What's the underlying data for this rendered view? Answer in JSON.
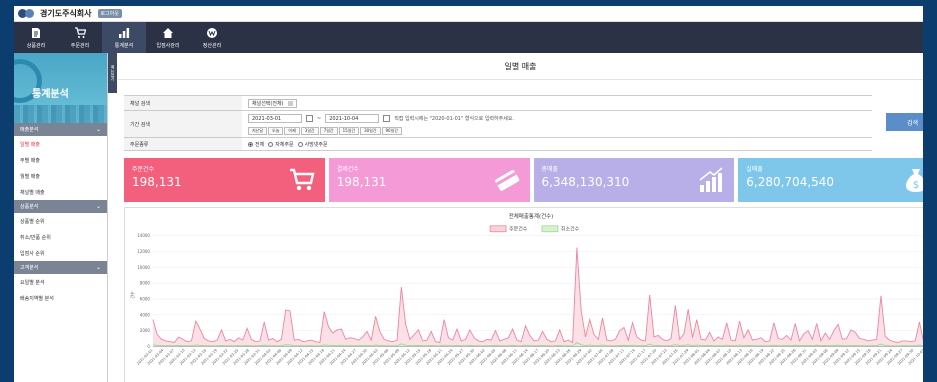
{
  "company": "경기도주식회사",
  "logout_label": "로그아웃",
  "nav": [
    {
      "label": "상품관리",
      "icon": "document-icon"
    },
    {
      "label": "주문관리",
      "icon": "cart-icon"
    },
    {
      "label": "통계분석",
      "icon": "bar-chart-icon",
      "active": true
    },
    {
      "label": "입점사관리",
      "icon": "home-icon"
    },
    {
      "label": "정산관리",
      "icon": "won-icon"
    }
  ],
  "sidebar": {
    "title": "통계분석",
    "toggle_label": "메뉴접기",
    "sections": [
      {
        "label": "매출분석",
        "items": [
          "일별 매출",
          "주별 매출",
          "월별 매출",
          "채널별 매출"
        ]
      },
      {
        "label": "상품분석",
        "items": [
          "상품별 순위",
          "취소/반품 순위",
          "입점사 순위"
        ]
      },
      {
        "label": "고객분석",
        "items": [
          "요일별 분석",
          "배송지역별 분석"
        ]
      }
    ],
    "active_item": "일별 매출"
  },
  "page_title": "일별 매출",
  "filter": {
    "channel_label": "채널 검색",
    "channel_value": "채널선택(전체)",
    "period_label": "기간 검색",
    "date_from": "2021-03-01",
    "date_sep": "~",
    "date_to": "2021-10-04",
    "hint": "직접 입력시에는 \"2020-01-01\" 형식으로 입력하주세요.",
    "quick": [
      "지난달",
      "오늘",
      "어제",
      "3일간",
      "7일간",
      "15일간",
      "30일간",
      "90일간"
    ],
    "order_type_label": "주문종류",
    "order_types": [
      "전체",
      "자체주문",
      "사방넷주문"
    ],
    "order_type_selected": "전체",
    "search_label": "검색"
  },
  "cards": [
    {
      "label": "주문건수",
      "value": "198,131",
      "color": "#f2607e",
      "icon": "cart-icon"
    },
    {
      "label": "결제건수",
      "value": "198,131",
      "color": "#f49ad6",
      "icon": "card-icon"
    },
    {
      "label": "총매출",
      "value": "6,348,130,310",
      "color": "#b8aee8",
      "icon": "growth-chart-icon"
    },
    {
      "label": "실매출",
      "value": "6,280,704,540",
      "color": "#7ec7ea",
      "icon": "money-bag-icon"
    }
  ],
  "chart_data": {
    "type": "line",
    "title": "전체매출통계(건수)",
    "ylabel": "건수",
    "ylim": [
      0,
      14000
    ],
    "yticks": [
      0,
      2000,
      4000,
      6000,
      8000,
      10000,
      12000,
      14000
    ],
    "legend_position": "top",
    "x_start": "2021-03-01",
    "x_end": "2021-10-04",
    "x_tick_labels": [
      "2021-03-01",
      "2021-03-04",
      "2021-03-07",
      "2021-03-10",
      "2021-03-13",
      "2021-03-16",
      "2021-03-19",
      "2021-03-22",
      "2021-03-25",
      "2021-03-28",
      "2021-03-31",
      "2021-04-03",
      "2021-04-06",
      "2021-04-09",
      "2021-04-12",
      "2021-04-15",
      "2021-04-18",
      "2021-04-21",
      "2021-04-24",
      "2021-04-27",
      "2021-04-30",
      "2021-05-03",
      "2021-05-06",
      "2021-05-09",
      "2021-05-12",
      "2021-05-15",
      "2021-05-18",
      "2021-05-21",
      "2021-05-24",
      "2021-05-27",
      "2021-05-30",
      "2021-06-02",
      "2021-06-05",
      "2021-06-08",
      "2021-06-11",
      "2021-06-14",
      "2021-06-17",
      "2021-06-20",
      "2021-06-23",
      "2021-06-26",
      "2021-06-29",
      "2021-07-02",
      "2021-07-05",
      "2021-07-08",
      "2021-07-11",
      "2021-07-14",
      "2021-07-17",
      "2021-07-20",
      "2021-07-23",
      "2021-07-26",
      "2021-07-29",
      "2021-08-01",
      "2021-08-04",
      "2021-08-07",
      "2021-08-10",
      "2021-08-13",
      "2021-08-16",
      "2021-08-19",
      "2021-08-22",
      "2021-08-25",
      "2021-08-28",
      "2021-08-31",
      "2021-09-03",
      "2021-09-06",
      "2021-09-09",
      "2021-09-12",
      "2021-09-15",
      "2021-09-18",
      "2021-09-21",
      "2021-09-24",
      "2021-09-27",
      "2021-09-30",
      "2021-10-03"
    ],
    "series": [
      {
        "name": "주문건수",
        "color": "#f0859f",
        "fill": "#f9d3dc",
        "values": [
          3400,
          1500,
          900,
          700,
          600,
          500,
          1200,
          900,
          600,
          700,
          3200,
          2200,
          1000,
          700,
          600,
          800,
          2100,
          700,
          900,
          600,
          1100,
          800,
          2300,
          900,
          600,
          700,
          3100,
          800,
          1000,
          600,
          900,
          4600,
          4500,
          800,
          900,
          600,
          700,
          800,
          600,
          500,
          4400,
          2500,
          1700,
          2100,
          2200,
          900,
          1100,
          1000,
          800,
          1200,
          1900,
          800,
          3800,
          1900,
          900,
          700,
          600,
          800,
          7500,
          2800,
          900,
          1500,
          2100,
          700,
          800,
          1900,
          600,
          500,
          3400,
          1100,
          800,
          2200,
          700,
          900,
          2100,
          1100,
          700,
          600,
          900,
          800,
          2000,
          700,
          900,
          1100,
          2200,
          800,
          600,
          2600,
          1400,
          700,
          800,
          1900,
          900,
          600,
          700,
          2100,
          600,
          800,
          500,
          12500,
          4500,
          1200,
          3400,
          1500,
          900,
          3600,
          800,
          700,
          900,
          2000,
          2400,
          800,
          3000,
          1200,
          800,
          700,
          6500,
          1200,
          1400,
          900,
          700,
          1000,
          5200,
          900,
          1600,
          4700,
          1100,
          3400,
          900,
          800,
          1800,
          700,
          1200,
          900,
          3000,
          800,
          700,
          3200,
          1100,
          2100,
          800,
          900,
          1100,
          600,
          700,
          3000,
          1000,
          900,
          1400,
          800,
          2900,
          700,
          1600,
          2000,
          900,
          2900,
          700,
          1700,
          900,
          2000,
          2800,
          900,
          1000,
          2100,
          1800,
          1000,
          900,
          700,
          800,
          900,
          6400,
          1300,
          800,
          600,
          500,
          700,
          700,
          600,
          700,
          3100,
          500,
          400
        ]
      },
      {
        "name": "취소건수",
        "color": "#9fd98f",
        "fill": "#d7f0cf",
        "values": [
          200,
          150,
          100,
          100,
          90,
          80,
          120,
          100,
          90,
          100,
          180,
          150,
          100,
          90,
          80,
          90,
          130,
          90,
          100,
          80,
          110,
          90,
          140,
          100,
          80,
          90,
          170,
          90,
          100,
          80,
          100,
          220,
          210,
          90,
          100,
          80,
          90,
          90,
          80,
          70,
          200,
          150,
          120,
          130,
          140,
          100,
          110,
          100,
          90,
          120,
          130,
          90,
          190,
          120,
          100,
          90,
          80,
          90,
          320,
          160,
          100,
          110,
          130,
          90,
          90,
          120,
          80,
          70,
          180,
          100,
          90,
          130,
          90,
          100,
          130,
          100,
          90,
          80,
          100,
          90,
          120,
          90,
          100,
          100,
          130,
          90,
          80,
          150,
          110,
          90,
          90,
          120,
          100,
          80,
          90,
          130,
          80,
          90,
          70,
          500,
          220,
          100,
          180,
          110,
          100,
          190,
          90,
          90,
          100,
          130,
          140,
          90,
          160,
          100,
          90,
          90,
          300,
          100,
          110,
          100,
          90,
          100,
          250,
          100,
          120,
          230,
          100,
          180,
          100,
          90,
          120,
          90,
          100,
          100,
          160,
          90,
          90,
          170,
          100,
          130,
          90,
          100,
          100,
          80,
          90,
          160,
          100,
          100,
          110,
          90,
          150,
          90,
          120,
          130,
          100,
          150,
          90,
          120,
          100,
          130,
          150,
          100,
          100,
          130,
          120,
          100,
          100,
          90,
          90,
          100,
          300,
          110,
          90,
          80,
          70,
          90,
          90,
          80,
          90,
          170,
          70,
          60
        ]
      }
    ]
  }
}
